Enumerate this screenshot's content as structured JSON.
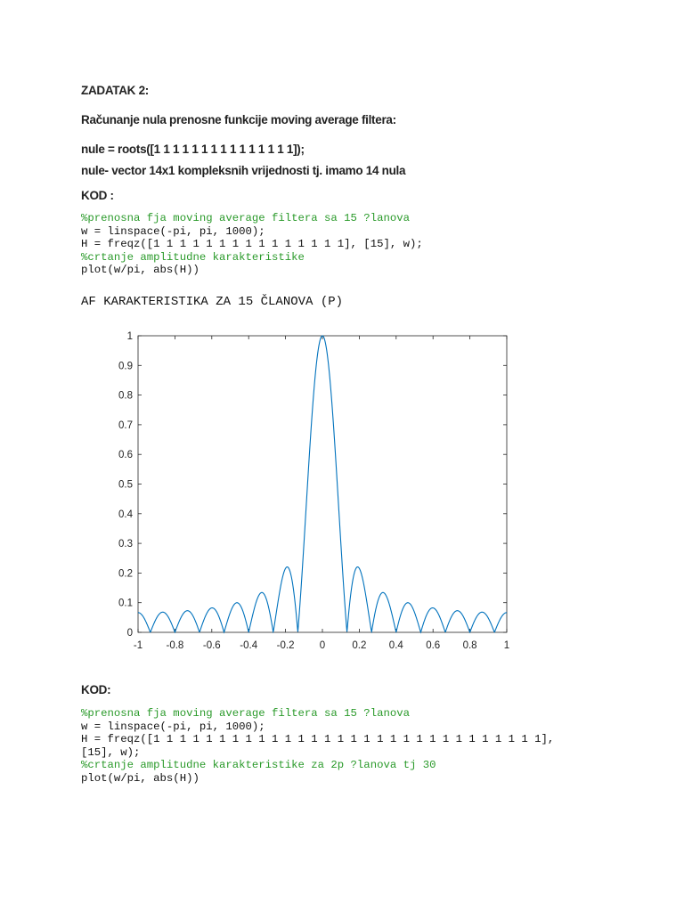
{
  "doc": {
    "title": "ZADATAK 2:",
    "line1": "Računanje nula prenosne funkcije moving average filtera:",
    "line2": "nule = roots([1 1 1 1 1 1 1 1 1 1 1 1 1 1 1]);",
    "line3": "nule- vector 14x1 kompleksnih vrijednosti tj. imamo 14 nula",
    "kod1": "KOD :",
    "code1": [
      {
        "text": "%prenosna fja moving average filtera sa 15 ?lanova",
        "comment": true
      },
      {
        "text": "w = linspace(-pi, pi, 1000);",
        "comment": false
      },
      {
        "text": "H = freqz([1 1 1 1 1 1 1 1 1 1 1 1 1 1 1], [15], w);",
        "comment": false
      },
      {
        "text": "%crtanje amplitudne karakteristike",
        "comment": true
      },
      {
        "text": "plot(w/pi, abs(H))",
        "comment": false
      }
    ],
    "heading": "AF KARAKTERISTIKA ZA 15 ČLANOVA (P)",
    "kod2": "KOD:",
    "code2": [
      {
        "text": "%prenosna fja moving average filtera sa 15 ?lanova",
        "comment": true
      },
      {
        "text": "w = linspace(-pi, pi, 1000);",
        "comment": false
      },
      {
        "text": "H = freqz([1 1 1 1 1 1 1 1 1 1 1 1 1 1 1 1 1 1 1 1 1 1 1 1 1 1 1 1 1 1],",
        "comment": false
      },
      {
        "text": "[15], w);",
        "comment": false
      },
      {
        "text": "%crtanje amplitudne karakteristike za 2p ?lanova tj 30",
        "comment": true
      },
      {
        "text": "plot(w/pi, abs(H))",
        "comment": false
      }
    ]
  },
  "chart_data": {
    "type": "line",
    "title": "",
    "xlabel": "",
    "ylabel": "",
    "xlim": [
      -1,
      1
    ],
    "ylim": [
      0,
      1
    ],
    "xticks": [
      "-1",
      "-0.8",
      "-0.6",
      "-0.4",
      "-0.2",
      "0",
      "0.2",
      "0.4",
      "0.6",
      "0.8",
      "1"
    ],
    "yticks": [
      "0",
      "0.1",
      "0.2",
      "0.3",
      "0.4",
      "0.5",
      "0.6",
      "0.7",
      "0.8",
      "0.9",
      "1"
    ],
    "series": [
      {
        "name": "abs(H)",
        "function": "|sin(N*pi*x/2) / (N*sin(pi*x/2))|",
        "N": 15,
        "samples": 1000,
        "x_range": [
          -1,
          1
        ],
        "color": "#0072bd"
      }
    ],
    "grid": false
  }
}
